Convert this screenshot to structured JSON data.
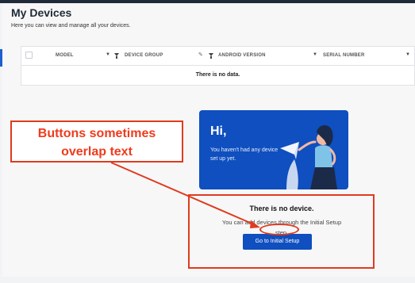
{
  "header": {
    "title": "My Devices",
    "subtitle": "Here you can view and manage all your devices."
  },
  "table": {
    "columns": [
      "MODEL",
      "DEVICE GROUP",
      "ANDROID VERSION",
      "SERIAL NUMBER"
    ],
    "empty_text": "There is no data."
  },
  "card": {
    "greeting": "Hi,",
    "message": "You haven't had any device set up yet."
  },
  "empty_state": {
    "title": "There is no device.",
    "description_a": "You can add devices through the Initial Setup",
    "description_b": "step.",
    "button_label": "Go to Initial Setup"
  },
  "annotation": {
    "callout_line1": "Buttons sometimes",
    "callout_line2": "overlap text",
    "color": "#e03a1e"
  },
  "colors": {
    "primary": "#0f4fbf",
    "title": "#1e2a38",
    "annotation_text": "#ef3b1c"
  }
}
